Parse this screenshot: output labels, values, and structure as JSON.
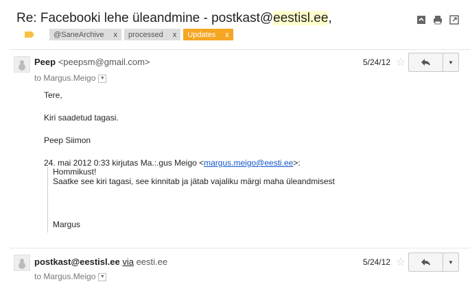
{
  "thread": {
    "subject_prefix": "Re: Facebooki lehe üleandmine - postkast@",
    "subject_highlight": "eestisl.ee",
    "subject_suffix": ",",
    "labels": [
      {
        "name": "@SaneArchive",
        "remove": "x"
      },
      {
        "name": "processed",
        "remove": "x"
      },
      {
        "name": "Updates",
        "remove": "x",
        "color": "#f5a623"
      }
    ]
  },
  "header_icons": [
    "archive-icon",
    "print-icon",
    "new-window-icon"
  ],
  "messages": [
    {
      "sender_name": "Peep",
      "sender_email": "<peepsm@gmail.com>",
      "to_text": "to Margus.Meigo",
      "date": "5/24/12",
      "body_lines": [
        "Tere,",
        "Kiri saadetud tagasi.",
        "Peep Siimon"
      ],
      "quote_header_prefix": "24. mai 2012 0:33 kirjutas Ma.:.gus Meigo <",
      "quote_header_link": "margus.meigo@eesti.ee",
      "quote_header_suffix": ">:",
      "quote_lines": [
        "Hommikust!",
        "Saatke see kiri tagasi, see kinnitab ja jätab vajaliku märgi maha üleandmisest",
        "Margus"
      ]
    },
    {
      "sender_name": "postkast@eestisl.ee",
      "via_label": "via",
      "via_domain": "eesti.ee",
      "to_text": "to Margus.Meigo",
      "date": "5/24/12"
    }
  ],
  "glyphs": {
    "star": "☆",
    "reply": "⮌",
    "dropdown": "▼"
  }
}
